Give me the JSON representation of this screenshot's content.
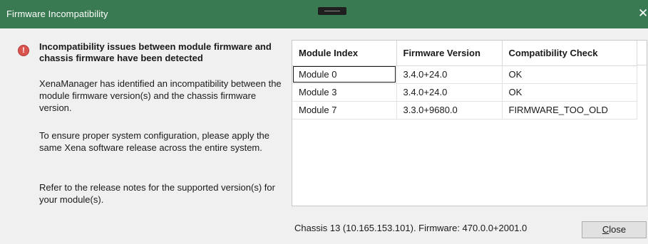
{
  "window": {
    "title": "Firmware Incompatibility",
    "close_glyph": "✕"
  },
  "icons": {
    "warning": "!"
  },
  "colors": {
    "titlebar": "#3a7a52",
    "warning_icon": "#d9534f"
  },
  "message": {
    "heading": "Incompatibility issues between module firmware and chassis firmware have been detected",
    "paragraph1": "XenaManager has identified an incompatibility between the module firmware version(s) and the chassis firmware version.",
    "paragraph2": "To ensure proper system configuration, please apply the same Xena software release across the entire system.",
    "paragraph3": "Refer to the release notes for the supported version(s) for your module(s)."
  },
  "table": {
    "columns": [
      "Module Index",
      "Firmware Version",
      "Compatibility Check"
    ],
    "rows": [
      [
        "Module 0",
        "3.4.0+24.0",
        "OK"
      ],
      [
        "Module 3",
        "3.4.0+24.0",
        "OK"
      ],
      [
        "Module 7",
        "3.3.0+9680.0",
        "FIRMWARE_TOO_OLD"
      ]
    ]
  },
  "footer": {
    "chassis_info": "Chassis 13 (10.165.153.101). Firmware: 470.0.0+2001.0",
    "close_accel": "C",
    "close_rest": "lose"
  }
}
